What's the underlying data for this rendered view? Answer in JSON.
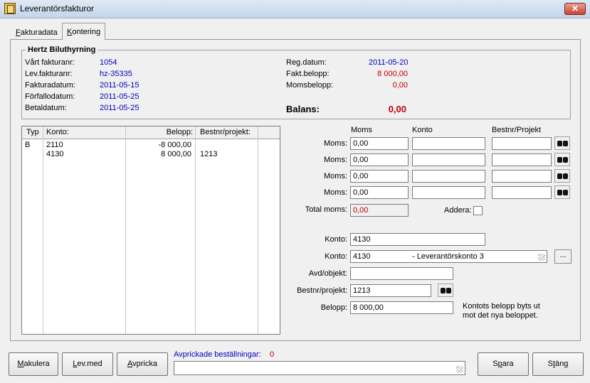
{
  "window": {
    "title": "Leverantörsfakturor",
    "close_label": "✕"
  },
  "tabs": [
    {
      "label": "Fakturadata",
      "mnemonic": "F",
      "rest": "akturadata"
    },
    {
      "label": "Kontering",
      "mnemonic": "K",
      "rest": "ontering"
    }
  ],
  "header": {
    "company": "Hertz Biluthyrning",
    "vart_fakturanr_label": "Vårt fakturanr:",
    "vart_fakturanr": "1054",
    "lev_fakturanr_label": "Lev.fakturanr:",
    "lev_fakturanr": "hz-35335",
    "fakturadatum_label": "Fakturadatum:",
    "fakturadatum": "2011-05-15",
    "forfallodatum_label": "Förfallodatum:",
    "forfallodatum": "2011-05-25",
    "betaldatum_label": "Betaldatum:",
    "betaldatum": "2011-05-25",
    "reg_datum_label": "Reg.datum:",
    "reg_datum": "2011-05-20",
    "fakt_belopp_label": "Fakt.belopp:",
    "fakt_belopp": "8 000,00",
    "momsbelopp_label": "Momsbelopp:",
    "momsbelopp": "0,00",
    "balans_label": "Balans:",
    "balans": "0,00"
  },
  "grid": {
    "columns": [
      "Typ",
      "Konto:",
      "Belopp:",
      "Bestnr/projekt:"
    ],
    "rows": [
      {
        "typ": "B",
        "konto": "2110",
        "belopp": "-8 000,00",
        "bestnr": ""
      },
      {
        "typ": "",
        "konto": "4130",
        "belopp": "8 000,00",
        "bestnr": "1213"
      }
    ]
  },
  "moms": {
    "col_moms": "Moms",
    "col_konto": "Konto",
    "col_bestnr": "Bestnr/Projekt",
    "row_label": "Moms:",
    "rows": [
      {
        "moms": "0,00"
      },
      {
        "moms": "0,00"
      },
      {
        "moms": "0,00"
      },
      {
        "moms": "0,00"
      }
    ],
    "total_label": "Total moms:",
    "total": "0,00",
    "addera_label": "Addera:"
  },
  "form": {
    "konto1_label": "Konto:",
    "konto1": "4130",
    "konto2_label": "Konto:",
    "konto2_num": "4130",
    "konto2_name": "- Leverantörskonto 3",
    "browse_label": "...",
    "avd_label": "Avd/objekt:",
    "avd": "",
    "bestnr_label": "Bestnr/projekt:",
    "bestnr": "1213",
    "belopp_label": "Belopp:",
    "belopp": "8 000,00",
    "info_line1": "Kontots belopp byts ut",
    "info_line2": "mot det nya beloppet."
  },
  "footer": {
    "makulera": {
      "mn": "M",
      "rest": "akulera"
    },
    "levmed": {
      "mn": "L",
      "rest": "ev.med"
    },
    "avpricka": {
      "mn": "A",
      "rest": "vpricka"
    },
    "avprickade_label": "Avprickade beställningar:",
    "avprickade_count": "0",
    "spara": {
      "pre": "S",
      "mn": "p",
      "rest": "ara"
    },
    "stang": {
      "pre": "S",
      "mn": "t",
      "rest": "äng"
    }
  },
  "colors": {
    "value_blue": "#0000c0",
    "value_red": "#c00000"
  }
}
